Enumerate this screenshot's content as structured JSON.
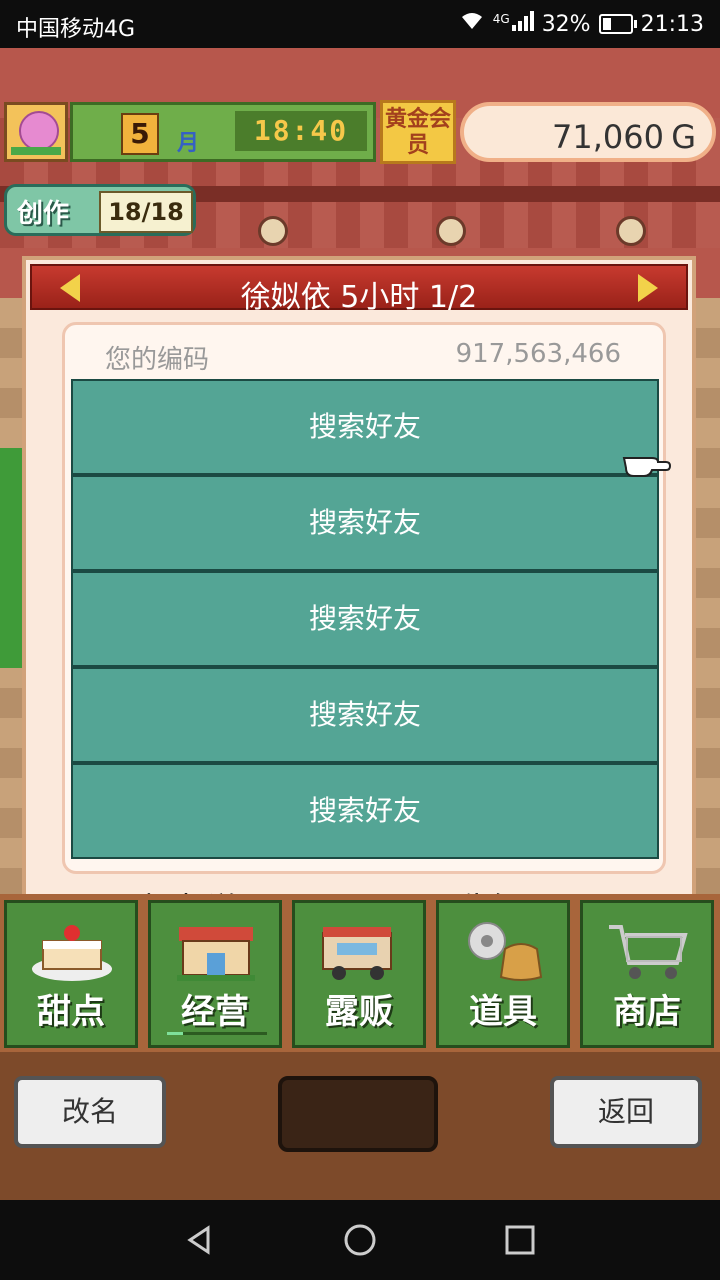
{
  "status_bar": {
    "carrier": "中国移动4G",
    "network": "4G",
    "battery": "32%",
    "battery_level": 0.32,
    "time": "21:13"
  },
  "hud": {
    "month": "5",
    "month_label": "月",
    "clock": "18:40",
    "gold_member": "黄金会员",
    "money": "71,060",
    "currency": "G",
    "create_label": "创作",
    "create_count": "18/18"
  },
  "dialog": {
    "title": "徐姒依  5小时 1/2",
    "code_label": "您的编码",
    "code_value": "917,563,466",
    "rows": [
      {
        "label": "搜索好友"
      },
      {
        "label": "搜索好友"
      },
      {
        "label": "搜索好友"
      },
      {
        "label": "搜索好友"
      },
      {
        "label": "搜索好友"
      }
    ],
    "friend_help": "好友说明",
    "notice": "告知号"
  },
  "tabs": [
    {
      "label": "甜点",
      "icon": "cake-icon"
    },
    {
      "label": "经营",
      "icon": "shop-icon"
    },
    {
      "label": "露贩",
      "icon": "truck-icon"
    },
    {
      "label": "道具",
      "icon": "items-icon"
    },
    {
      "label": "商店",
      "icon": "cart-icon"
    }
  ],
  "footer": {
    "rename": "改名",
    "back": "返回"
  },
  "colors": {
    "row_bg": "#54a595",
    "title_red": "#b02c22",
    "tab_green": "#4d8f3e"
  }
}
